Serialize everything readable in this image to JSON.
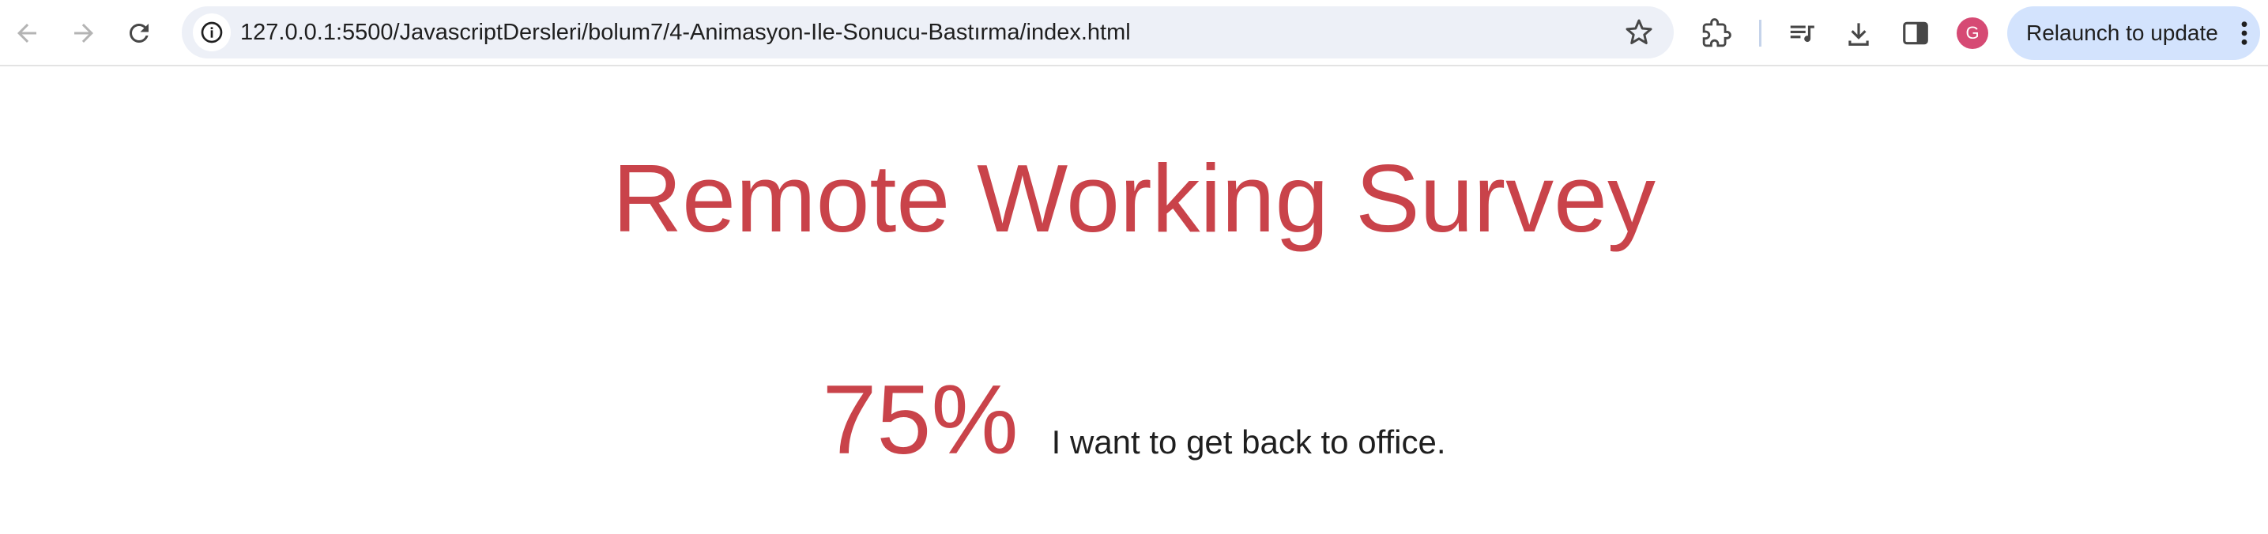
{
  "browser": {
    "url": "127.0.0.1:5500/JavascriptDersleri/bolum7/4-Animasyon-Ile-Sonucu-Bastırma/index.html",
    "profile_initial": "G",
    "relaunch_label": "Relaunch to update",
    "icons": {
      "back": "arrow-left-icon",
      "forward": "arrow-right-icon",
      "reload": "reload-icon",
      "site_info": "info-icon",
      "bookmark": "star-icon",
      "extensions": "puzzle-icon",
      "media": "queue-music-icon",
      "downloads": "download-icon",
      "side_panel": "side-panel-icon",
      "menu": "more-vert-icon"
    },
    "colors": {
      "omnibox_bg": "#edf0f7",
      "relaunch_bg": "#d3e3fd",
      "avatar_bg": "#d64a74"
    }
  },
  "page": {
    "title": "Remote Working Survey",
    "result_percent": "75%",
    "result_statement": "I want to get back to office.",
    "accent_color": "#c9434a"
  }
}
